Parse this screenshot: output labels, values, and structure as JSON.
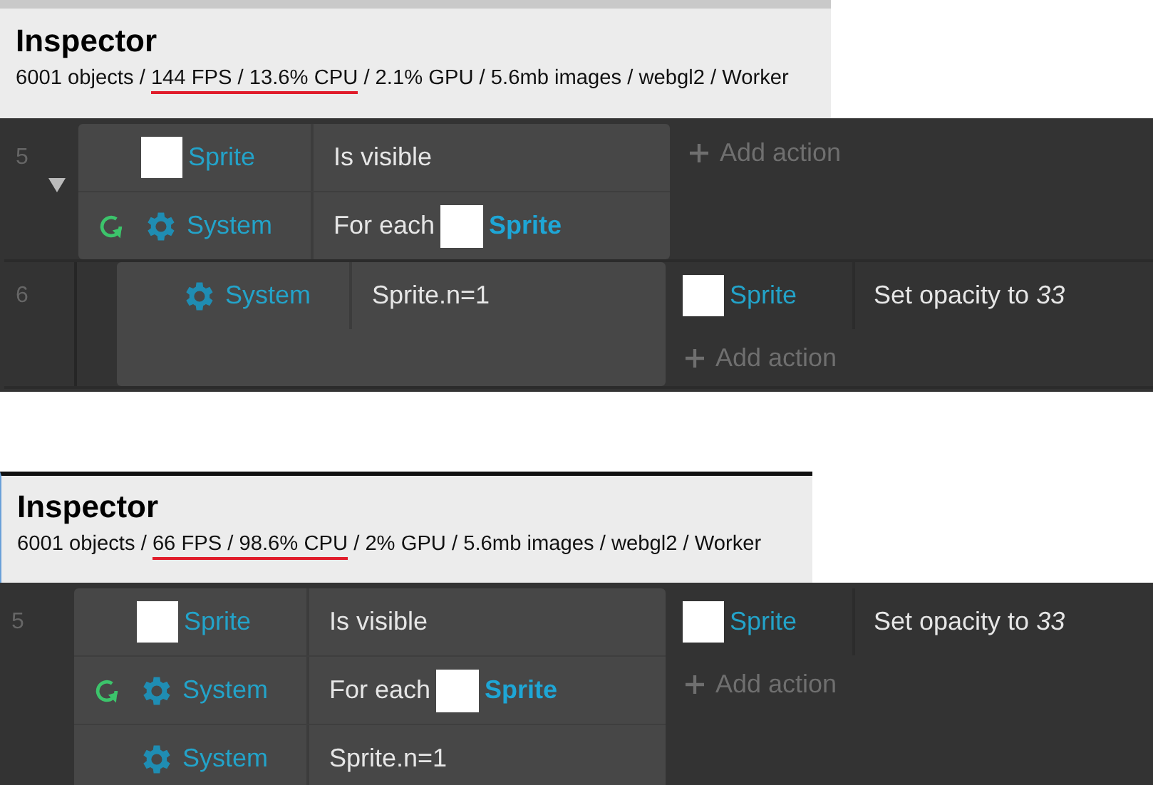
{
  "panels": [
    {
      "inspector": {
        "title": "Inspector",
        "stats_before": "6001 objects / ",
        "stats_highlight": "144 FPS / 13.6% CPU",
        "stats_after": " / 2.1% GPU / 5.6mb images / webgl2 / Worker"
      },
      "events": [
        {
          "number": "5",
          "expanded": true,
          "conditions": [
            {
              "kind": "object",
              "object": "Sprite",
              "text": "Is visible"
            },
            {
              "kind": "system",
              "loop": true,
              "object": "System",
              "text": "For each",
              "param": "Sprite"
            }
          ],
          "add_action": "Add action",
          "children": [
            {
              "number": "6",
              "conditions": [
                {
                  "kind": "system",
                  "object": "System",
                  "text": "Sprite.n=1"
                }
              ],
              "actions": [
                {
                  "kind": "object",
                  "object": "Sprite",
                  "text": "Set opacity to *33*"
                }
              ],
              "add_action": "Add action"
            }
          ]
        }
      ]
    },
    {
      "inspector": {
        "title": "Inspector",
        "stats_before": "6001 objects / ",
        "stats_highlight": "66 FPS / 98.6% CPU",
        "stats_after": " / 2% GPU / 5.6mb images / webgl2 / Worker"
      },
      "events": [
        {
          "number": "5",
          "conditions": [
            {
              "kind": "object",
              "object": "Sprite",
              "text": "Is visible"
            },
            {
              "kind": "system",
              "loop": true,
              "object": "System",
              "text": "For each",
              "param": "Sprite"
            },
            {
              "kind": "system",
              "object": "System",
              "text": "Sprite.n=1"
            }
          ],
          "actions": [
            {
              "kind": "object",
              "object": "Sprite",
              "text": "Set opacity to *33*"
            }
          ],
          "add_action": "Add action"
        }
      ]
    }
  ]
}
